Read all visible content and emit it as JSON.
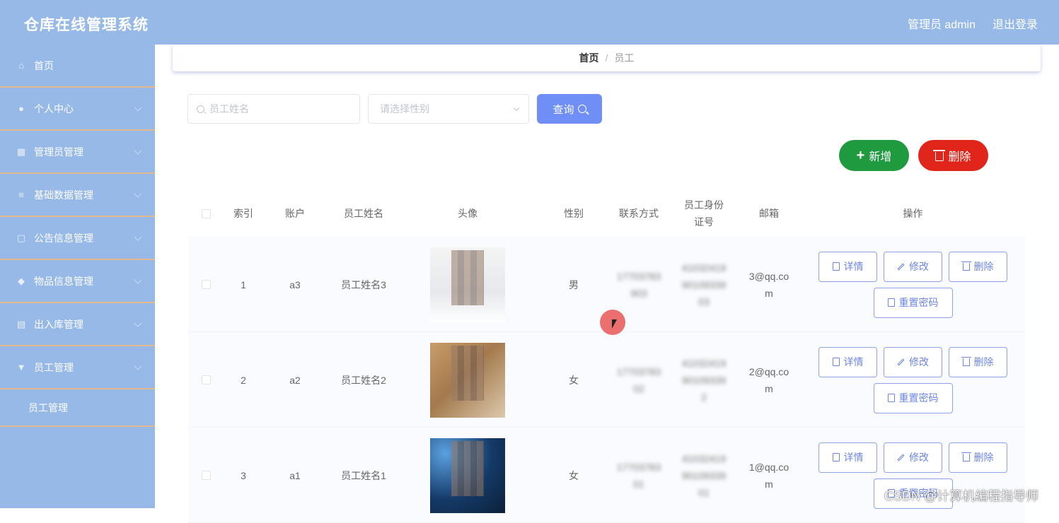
{
  "header": {
    "title": "仓库在线管理系统",
    "user_label": "管理员 admin",
    "logout_label": "退出登录"
  },
  "sidebar": {
    "items": [
      {
        "label": "首页",
        "icon": "home-icon"
      },
      {
        "label": "个人中心",
        "icon": "user-icon"
      },
      {
        "label": "管理员管理",
        "icon": "admin-icon"
      },
      {
        "label": "基础数据管理",
        "icon": "list-icon"
      },
      {
        "label": "公告信息管理",
        "icon": "notice-icon"
      },
      {
        "label": "物品信息管理",
        "icon": "goods-icon"
      },
      {
        "label": "出入库管理",
        "icon": "inout-icon"
      },
      {
        "label": "员工管理",
        "icon": "employee-icon"
      }
    ],
    "sub_item": "员工管理"
  },
  "breadcrumb": {
    "home": "首页",
    "separator": "/",
    "current": "员工"
  },
  "search": {
    "name_placeholder": "员工姓名",
    "gender_placeholder": "请选择性别",
    "query_label": "查询"
  },
  "toolbar": {
    "add_label": "新增",
    "delete_label": "删除"
  },
  "table": {
    "headers": [
      "索引",
      "账户",
      "员工姓名",
      "头像",
      "性别",
      "联系方式",
      "员工身份证号",
      "邮箱",
      "操作"
    ],
    "header_id_line1": "员工身份",
    "header_id_line2": "证号",
    "rows": [
      {
        "index": "1",
        "account": "a3",
        "name": "员工姓名3",
        "gender": "男",
        "phone_line1": "17703783",
        "phone_line2": "903",
        "id_line1": "41032419",
        "id_line2": "90109339",
        "id_line3": "03",
        "email_line1": "3@qq.co",
        "email_line2": "m"
      },
      {
        "index": "2",
        "account": "a2",
        "name": "员工姓名2",
        "gender": "女",
        "phone_line1": "17703783",
        "phone_line2": "02",
        "id_line1": "41032419",
        "id_line2": "90109339",
        "id_line3": "2",
        "email_line1": "2@qq.co",
        "email_line2": "m"
      },
      {
        "index": "3",
        "account": "a1",
        "name": "员工姓名1",
        "gender": "女",
        "phone_line1": "17703783",
        "phone_line2": "01",
        "id_line1": "41032419",
        "id_line2": "90109339",
        "id_line3": "01",
        "email_line1": "1@qq.co",
        "email_line2": "m"
      }
    ],
    "actions": {
      "detail": "详情",
      "edit": "修改",
      "delete": "删除",
      "reset": "重置密码"
    }
  },
  "watermark": "CSDN @计算机编程指导师",
  "colors": {
    "header": "#96b9e7",
    "primary": "#6f8ef6",
    "success": "#1f9a3f",
    "danger": "#e0251b",
    "divider": "#e3b98d"
  }
}
